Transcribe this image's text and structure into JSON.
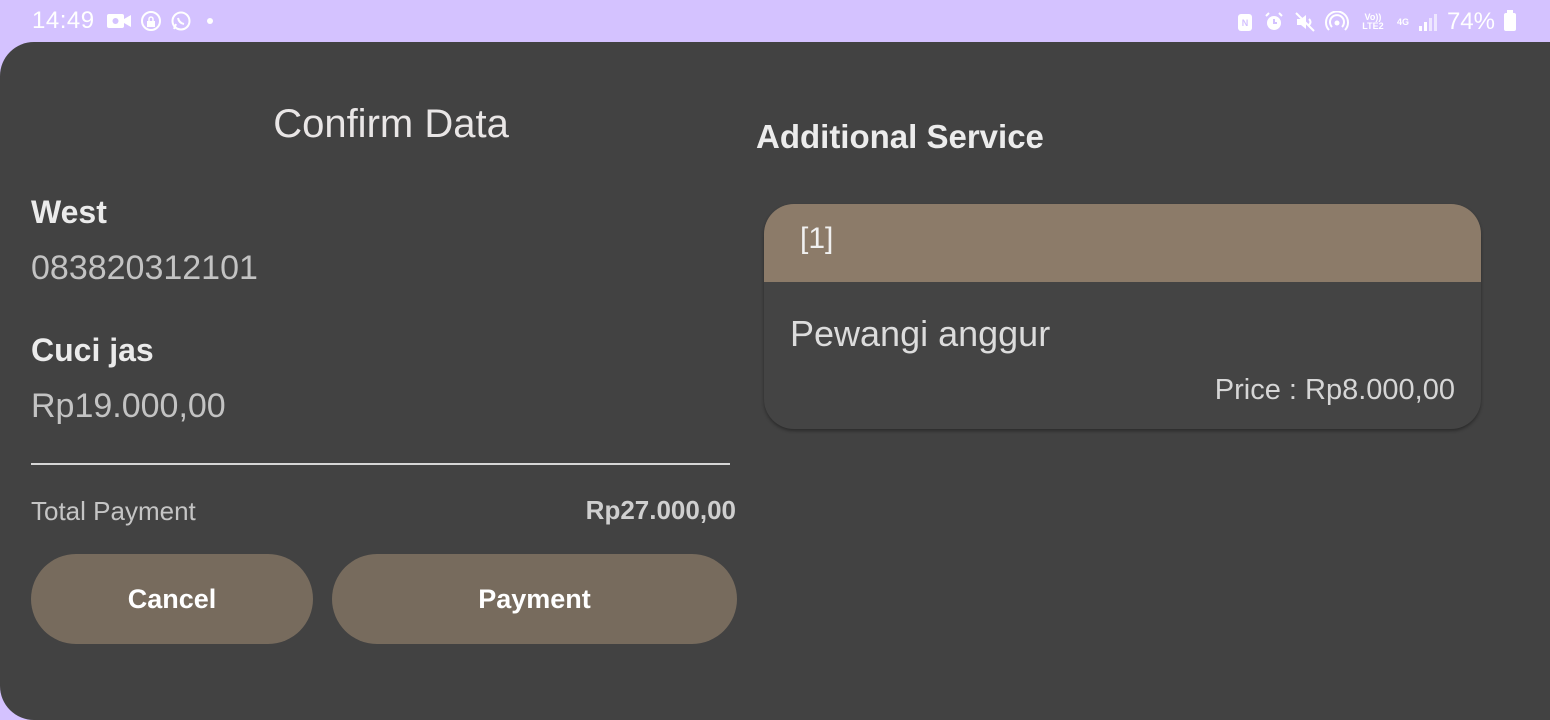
{
  "status_bar": {
    "time": "14:49",
    "battery": "74%",
    "network_top": "Vo)) LTE2",
    "signal_label": "4G"
  },
  "confirm": {
    "title": "Confirm Data",
    "customer_name": "West",
    "phone": "083820312101",
    "service_name": "Cuci jas",
    "service_price": "Rp19.000,00",
    "total_label": "Total Payment",
    "total_value": "Rp27.000,00",
    "cancel_label": "Cancel",
    "payment_label": "Payment"
  },
  "additional": {
    "title": "Additional Service",
    "items": [
      {
        "index": "[1]",
        "name": "Pewangi anggur",
        "price": "Price : Rp8.000,00"
      }
    ]
  },
  "colors": {
    "status_bar": "#d4c2ff",
    "background": "#424242",
    "button": "#776b5d",
    "card_header": "#8c7b69"
  }
}
